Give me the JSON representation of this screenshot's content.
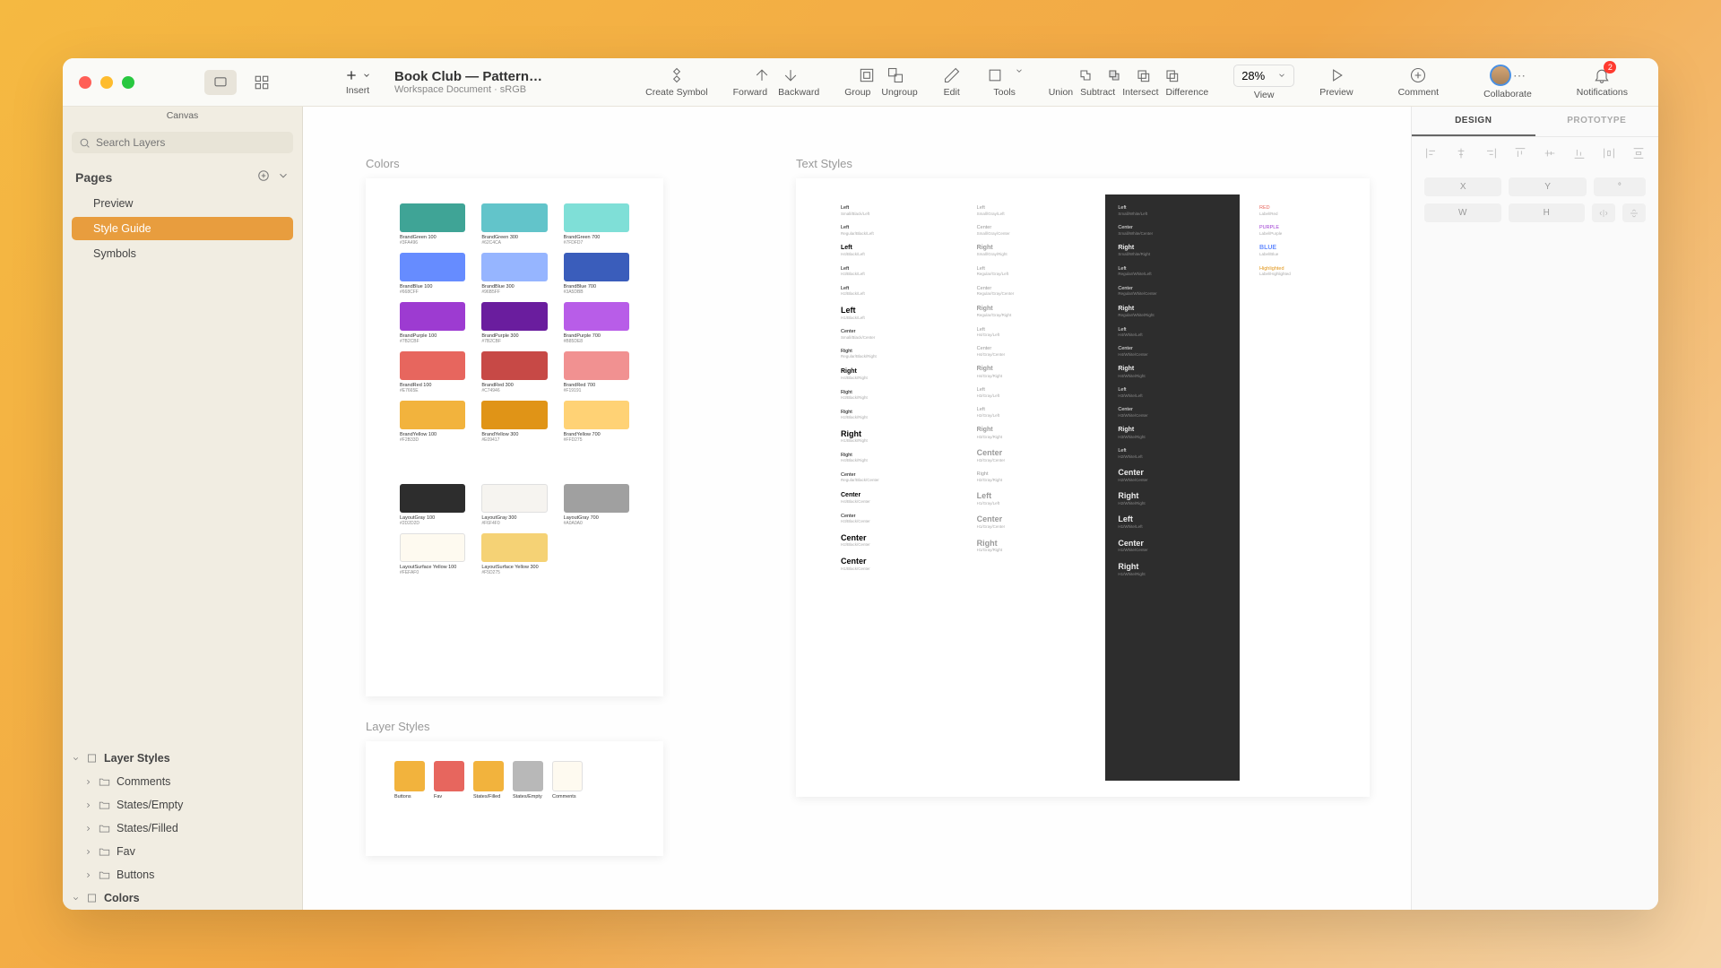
{
  "window": {
    "canvas_mode_label": "Canvas",
    "doc_title": "Book Club — Pattern…",
    "doc_subtitle": "Workspace Document · sRGB",
    "insert_label": "Insert"
  },
  "toolbar": {
    "create_symbol": "Create Symbol",
    "forward": "Forward",
    "backward": "Backward",
    "group": "Group",
    "ungroup": "Ungroup",
    "edit": "Edit",
    "tools": "Tools",
    "union": "Union",
    "subtract": "Subtract",
    "intersect": "Intersect",
    "difference": "Difference",
    "view": "View",
    "zoom": "28%",
    "preview": "Preview",
    "comment": "Comment",
    "collaborate": "Collaborate",
    "notifications": "Notifications",
    "notif_count": "2"
  },
  "sidebar": {
    "search_placeholder": "Search Layers",
    "pages_label": "Pages",
    "pages": [
      "Preview",
      "Style Guide",
      "Symbols"
    ],
    "selected_page": "Style Guide",
    "layer_styles_label": "Layer Styles",
    "layer_folders": [
      "Comments",
      "States/Empty",
      "States/Filled",
      "Fav",
      "Buttons"
    ],
    "colors_label": "Colors"
  },
  "canvas": {
    "colors_label": "Colors",
    "text_styles_label": "Text Styles",
    "layer_styles_label": "Layer Styles",
    "colors": [
      {
        "name": "BrandGreen 100",
        "hex": "#3FA496",
        "color": "#3fa496"
      },
      {
        "name": "BrandGreen 300",
        "hex": "#62C4CA",
        "color": "#62c4ca"
      },
      {
        "name": "BrandGreen 700",
        "hex": "#7FDFD7",
        "color": "#7fdfd7"
      },
      {
        "name": "BrandBlue 100",
        "hex": "#668CFF",
        "color": "#668cff"
      },
      {
        "name": "BrandBlue 300",
        "hex": "#96B5FF",
        "color": "#96b5ff"
      },
      {
        "name": "BrandBlue 700",
        "hex": "#3A5DBB",
        "color": "#3a5dbb"
      },
      {
        "name": "BrandPurple 100",
        "hex": "#7B2CBF",
        "color": "#9d3bd1"
      },
      {
        "name": "BrandPurple 300",
        "hex": "#7B2CBF",
        "color": "#6a1d9e"
      },
      {
        "name": "BrandPurple 700",
        "hex": "#B85DE8",
        "color": "#b85de8"
      },
      {
        "name": "BrandRed 100",
        "hex": "#E7665E",
        "color": "#e7665e"
      },
      {
        "name": "BrandRed 300",
        "hex": "#C74946",
        "color": "#c74946"
      },
      {
        "name": "BrandRed 700",
        "hex": "#F19191",
        "color": "#f19191"
      },
      {
        "name": "BrandYellow 100",
        "hex": "#F2B33D",
        "color": "#f2b33d"
      },
      {
        "name": "BrandYellow 300",
        "hex": "#E09417",
        "color": "#e09417"
      },
      {
        "name": "BrandYellow 700",
        "hex": "#FFD275",
        "color": "#ffd275"
      },
      {
        "name": "LayoutGray 100",
        "hex": "#2D2D2D",
        "color": "#2d2d2d"
      },
      {
        "name": "LayoutGray 300",
        "hex": "#F6F4F0",
        "color": "#f6f4f0"
      },
      {
        "name": "LayoutGray 700",
        "hex": "#A0A0A0",
        "color": "#a0a0a0"
      },
      {
        "name": "LayoutSurface Yellow 100",
        "hex": "#FEFAF0",
        "color": "#fefaf0"
      },
      {
        "name": "LayoutSurface Yellow 300",
        "hex": "#F5D275",
        "color": "#f5d275"
      }
    ],
    "layer_styles": [
      {
        "name": "Buttons",
        "color": "#f2b33d"
      },
      {
        "name": "Fav",
        "color": "#e7665e"
      },
      {
        "name": "States/Filled",
        "color": "#f2b33d"
      },
      {
        "name": "States/Empty",
        "color": "#b8b8b8"
      },
      {
        "name": "Comments",
        "color": "#fefaf0"
      }
    ],
    "text_cols": {
      "light1": [
        {
          "t": "Left",
          "s": "Small/Black/Left"
        },
        {
          "t": "Left",
          "s": "Regular/Black/Left"
        },
        {
          "t": "Left",
          "s": "H4/Black/Left"
        },
        {
          "t": "Left",
          "s": "H3/Black/Left"
        },
        {
          "t": "Left",
          "s": "H2/Black/Left"
        },
        {
          "t": "Left",
          "s": "H1/Black/Left",
          "big": true
        },
        {
          "t": "Center",
          "s": "Small/Black/Center"
        },
        {
          "t": "Right",
          "s": "Regular/Black/Right"
        },
        {
          "t": "Right",
          "s": "H4/Black/Right"
        },
        {
          "t": "Right",
          "s": "H3/Black/Right"
        },
        {
          "t": "Right",
          "s": "H2/Black/Right"
        },
        {
          "t": "Right",
          "s": "H1/Black/Right",
          "big": true
        },
        {
          "t": "Right",
          "s": "H4/Black/Right"
        },
        {
          "t": "Center",
          "s": "Regular/Black/Center"
        },
        {
          "t": "Center",
          "s": "H4/Black/Center"
        },
        {
          "t": "Center",
          "s": "H3/Black/Center"
        },
        {
          "t": "Center",
          "s": "H2/Black/Center",
          "big": true
        },
        {
          "t": "Center",
          "s": "H1/Black/Center",
          "big": true
        }
      ],
      "light2": [
        {
          "t": "Left",
          "s": "Small/Gray/Left"
        },
        {
          "t": "Center",
          "s": "Small/Gray/Center"
        },
        {
          "t": "Right",
          "s": "Small/Gray/Right"
        },
        {
          "t": "Left",
          "s": "Regular/Gray/Left"
        },
        {
          "t": "Center",
          "s": "Regular/Gray/Center"
        },
        {
          "t": "Right",
          "s": "Regular/Gray/Right"
        },
        {
          "t": "Left",
          "s": "H4/Gray/Left"
        },
        {
          "t": "Center",
          "s": "H4/Gray/Center"
        },
        {
          "t": "Right",
          "s": "H4/Gray/Right"
        },
        {
          "t": "Left",
          "s": "H3/Gray/Left"
        },
        {
          "t": "Left",
          "s": "H2/Gray/Left"
        },
        {
          "t": "Right",
          "s": "H3/Gray/Right"
        },
        {
          "t": "Center",
          "s": "H3/Gray/Center",
          "big": true
        },
        {
          "t": "Right",
          "s": "H2/Gray/Right"
        },
        {
          "t": "Left",
          "s": "H1/Gray/Left",
          "big": true
        },
        {
          "t": "Center",
          "s": "H1/Gray/Center",
          "big": true
        },
        {
          "t": "Right",
          "s": "H1/Gray/Right",
          "big": true
        }
      ],
      "dark": [
        {
          "t": "Left",
          "s": "Small/White/Left"
        },
        {
          "t": "Center",
          "s": "Small/White/Center"
        },
        {
          "t": "Right",
          "s": "Small/White/Right"
        },
        {
          "t": "Left",
          "s": "Regular/White/Left"
        },
        {
          "t": "Center",
          "s": "Regular/White/Center"
        },
        {
          "t": "Right",
          "s": "Regular/White/Right"
        },
        {
          "t": "Left",
          "s": "H4/White/Left"
        },
        {
          "t": "Center",
          "s": "H4/White/Center"
        },
        {
          "t": "Right",
          "s": "H4/White/Right"
        },
        {
          "t": "Left",
          "s": "H3/White/Left"
        },
        {
          "t": "Center",
          "s": "H3/White/Center"
        },
        {
          "t": "Right",
          "s": "H3/White/Right"
        },
        {
          "t": "Left",
          "s": "H2/White/Left"
        },
        {
          "t": "Center",
          "s": "H2/White/Center",
          "big": true
        },
        {
          "t": "Right",
          "s": "H2/White/Right",
          "big": true
        },
        {
          "t": "Left",
          "s": "H1/White/Left",
          "big": true
        },
        {
          "t": "Center",
          "s": "H1/White/Center",
          "big": true
        },
        {
          "t": "Right",
          "s": "H1/White/Right",
          "big": true
        }
      ],
      "accents": [
        {
          "t": "RED",
          "s": "Label/Red"
        },
        {
          "t": "PURPLE",
          "s": "Label/Purple"
        },
        {
          "t": "BLUE",
          "s": "Label/Blue"
        },
        {
          "t": "Highlighted",
          "s": "Label/Highlighted"
        }
      ]
    }
  },
  "inspector": {
    "design_tab": "DESIGN",
    "prototype_tab": "PROTOTYPE",
    "x": "X",
    "y": "Y",
    "w": "W",
    "h": "H",
    "angle": "°"
  }
}
